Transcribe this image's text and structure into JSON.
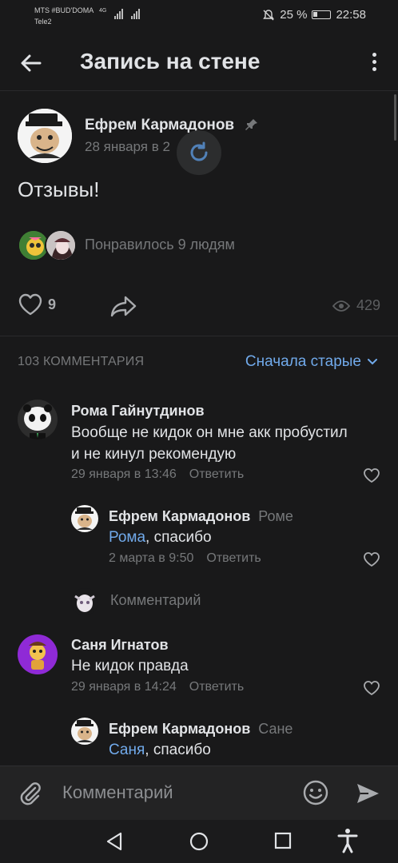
{
  "status_bar": {
    "carrier_line1": "MTS #BUD'DOMA",
    "carrier_line2": "Tele2",
    "network": "4G",
    "battery": "25 %",
    "time": "22:58"
  },
  "header": {
    "title": "Запись на стене"
  },
  "post": {
    "author": "Ефрем Кармадонов",
    "date": "28 января в 2",
    "text": "Отзывы!",
    "liked_text": "Понравилось 9 людям",
    "like_count": "9",
    "views": "429"
  },
  "comments_header": {
    "count_label": "103 КОММЕНТАРИЯ",
    "sort_label": "Сначала старые"
  },
  "comments": [
    {
      "name": "Рома Гайнутдинов",
      "text_line1": "Вообще не кидок он мне акк пробустил",
      "text_line2": "и не кинул рекомендую",
      "date": "29 января в 13:46",
      "reply": "Ответить"
    },
    {
      "name": "Ефрем Кармадонов",
      "reply_to": "Роме",
      "mention": "Рома",
      "text": ", спасибо",
      "date": "2 марта в 9:50",
      "reply": "Ответить"
    },
    {
      "name": "Саня Игнатов",
      "text_line1": "Не кидок правда",
      "date": "29 января в 14:24",
      "reply": "Ответить"
    },
    {
      "name": "Ефрем Кармадонов",
      "reply_to": "Сане",
      "mention": "Саня",
      "text": ", спасибо"
    }
  ],
  "inline_comment_placeholder": "Комментарий",
  "compose": {
    "placeholder": "Комментарий"
  },
  "colors": {
    "background": "#19191a",
    "accent": "#71aaeb",
    "secondary_text": "#76787a"
  }
}
